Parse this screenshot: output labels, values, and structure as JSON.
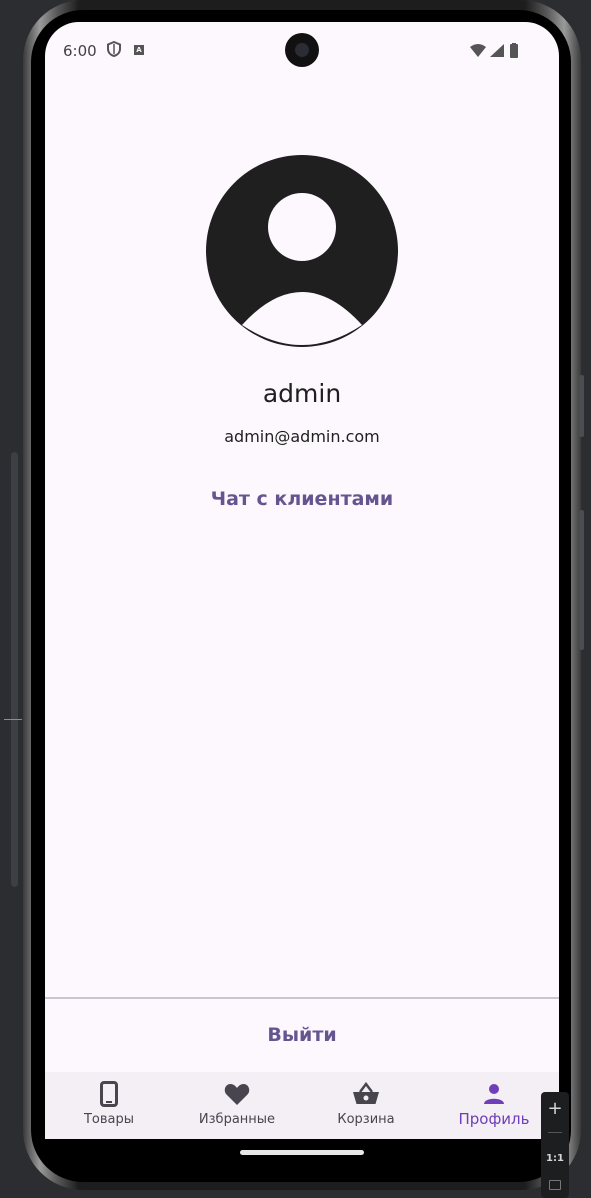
{
  "status_bar": {
    "time": "6:00",
    "badge_letter": "A",
    "icons": [
      "shield-icon",
      "wifi-icon",
      "signal-icon",
      "battery-icon"
    ]
  },
  "profile": {
    "username": "admin",
    "email": "admin@admin.com",
    "chat_button": "Чат с клиентами",
    "logout_button": "Выйти"
  },
  "nav": {
    "items": [
      {
        "label": "Товары",
        "icon": "phone-icon",
        "active": false
      },
      {
        "label": "Избранные",
        "icon": "heart-icon",
        "active": false
      },
      {
        "label": "Корзина",
        "icon": "basket-icon",
        "active": false
      },
      {
        "label": "Профиль",
        "icon": "person-icon",
        "active": true
      }
    ]
  },
  "zoom_widget": {
    "zoom_in": "+",
    "ratio": "1:1"
  },
  "colors": {
    "background": "#fdf7fe",
    "accent": "#65558f",
    "nav_active": "#6e3fb9",
    "text": "#1f1f1f"
  }
}
